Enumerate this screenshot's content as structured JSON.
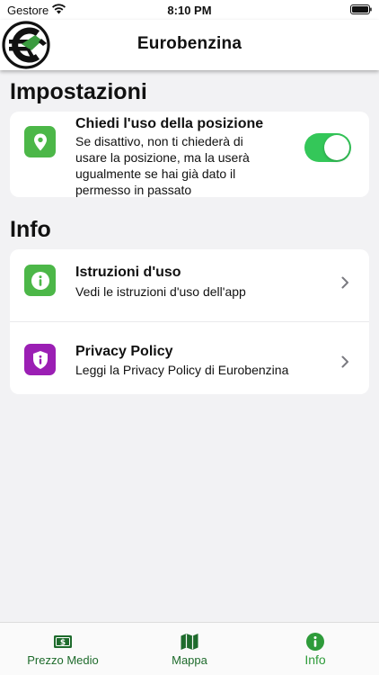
{
  "status_bar": {
    "carrier": "Gestore",
    "time": "8:10 PM"
  },
  "nav": {
    "title": "Eurobenzina",
    "logo_icon": "eurobenzina-logo"
  },
  "settings": {
    "title": "Impostazioni",
    "location": {
      "icon": "location-pin-icon",
      "title": "Chiedi l'uso della posizione",
      "subtitle_lines": [
        "Se disattivo, non ti chiederà di",
        "usare la posizione, ma la userà",
        "ugualmente se hai già dato il",
        "permesso in passato"
      ],
      "toggle_on": true
    }
  },
  "info": {
    "title": "Info",
    "items": [
      {
        "icon": "info-icon",
        "title": "Istruzioni d'uso",
        "subtitle": "Vedi le istruzioni d'uso dell'app"
      },
      {
        "icon": "privacy-shield-icon",
        "title": "Privacy Policy",
        "subtitle": "Leggi la Privacy Policy di Eurobenzina"
      }
    ]
  },
  "tabs": [
    {
      "label": "Prezzo Medio",
      "icon": "money-icon",
      "active": false
    },
    {
      "label": "Mappa",
      "icon": "map-icon",
      "active": false
    },
    {
      "label": "Info",
      "icon": "info-icon",
      "active": true
    }
  ],
  "colors": {
    "accent_green": "#4cb748",
    "privacy_purple": "#9b1fb4",
    "toggle_green": "#34c759",
    "tab_green": "#1e6b2c"
  }
}
